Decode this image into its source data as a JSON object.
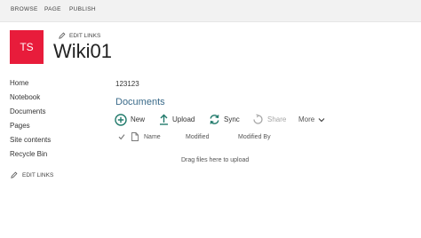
{
  "ribbon": {
    "tabs": [
      "BROWSE",
      "PAGE",
      "PUBLISH"
    ]
  },
  "site": {
    "logo_text": "TS",
    "logo_color": "#e81c3b",
    "title": "Wiki01",
    "edit_links_label": "EDIT LINKS"
  },
  "left_nav": {
    "items": [
      "Home",
      "Notebook",
      "Documents",
      "Pages",
      "Site contents",
      "Recycle Bin"
    ],
    "edit_links_label": "EDIT LINKS"
  },
  "main": {
    "text_content": "123123",
    "library_title": "Documents",
    "commands": [
      {
        "label": "New",
        "icon": "plus-circle-icon"
      },
      {
        "label": "Upload",
        "icon": "upload-arrow-icon"
      },
      {
        "label": "Sync",
        "icon": "sync-icon"
      },
      {
        "label": "Share",
        "icon": "share-icon"
      },
      {
        "label": "More",
        "icon": "chevron-down-icon"
      }
    ],
    "columns": [
      "Name",
      "Modified",
      "Modified By"
    ],
    "empty_message": "Drag files here to upload"
  },
  "colors": {
    "accent_teal": "#217a6b",
    "heading_blue": "#3b6b8a",
    "ribbon_bg": "#f2f2f2"
  }
}
